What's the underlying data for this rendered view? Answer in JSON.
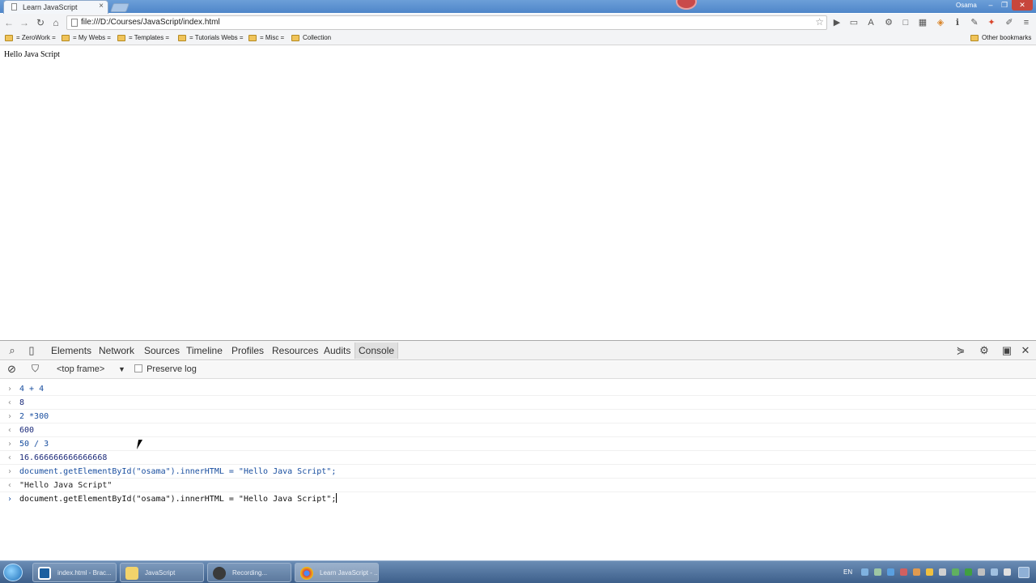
{
  "browser": {
    "tab_title": "Learn JavaScript",
    "user": "Osama",
    "url": "file:///D:/Courses/JavaScript/index.html",
    "bookmarks": [
      "= ZeroWork =",
      "= My Webs =",
      "= Templates =",
      "= Tutorials Webs =",
      "= Misc =",
      "Collection"
    ],
    "other_bookmarks": "Other bookmarks"
  },
  "page": {
    "content_text": "Hello Java Script"
  },
  "devtools": {
    "tabs": [
      "Elements",
      "Network",
      "Sources",
      "Timeline",
      "Profiles",
      "Resources",
      "Audits",
      "Console"
    ],
    "active_tab": "Console",
    "frame_selector": "<top frame>",
    "preserve_log_label": "Preserve log",
    "preserve_log_checked": false
  },
  "console": {
    "entries": [
      {
        "kind": "input",
        "text": "4 + 4"
      },
      {
        "kind": "result",
        "text": "8"
      },
      {
        "kind": "input",
        "text": "2 *300"
      },
      {
        "kind": "result",
        "text": "600"
      },
      {
        "kind": "input",
        "text": "50 / 3"
      },
      {
        "kind": "result",
        "text": "16.666666666666668"
      },
      {
        "kind": "input",
        "text": "document.getElementById(\"osama\").innerHTML = \"Hello Java Script\";"
      },
      {
        "kind": "result",
        "text": "\"Hello Java Script\""
      }
    ],
    "current_input": "document.getElementById(\"osama\").innerHTML = \"Hello Java Script\";"
  },
  "taskbar": {
    "tasks": [
      "index.html - Brac...",
      "JavaScript",
      "Recording...",
      "Learn JavaScript - ..."
    ],
    "language": "EN"
  },
  "colors": {
    "console_input": "#1a4fa0",
    "console_result": "#1c2b7a",
    "titlebar": "#5a8fd0"
  }
}
